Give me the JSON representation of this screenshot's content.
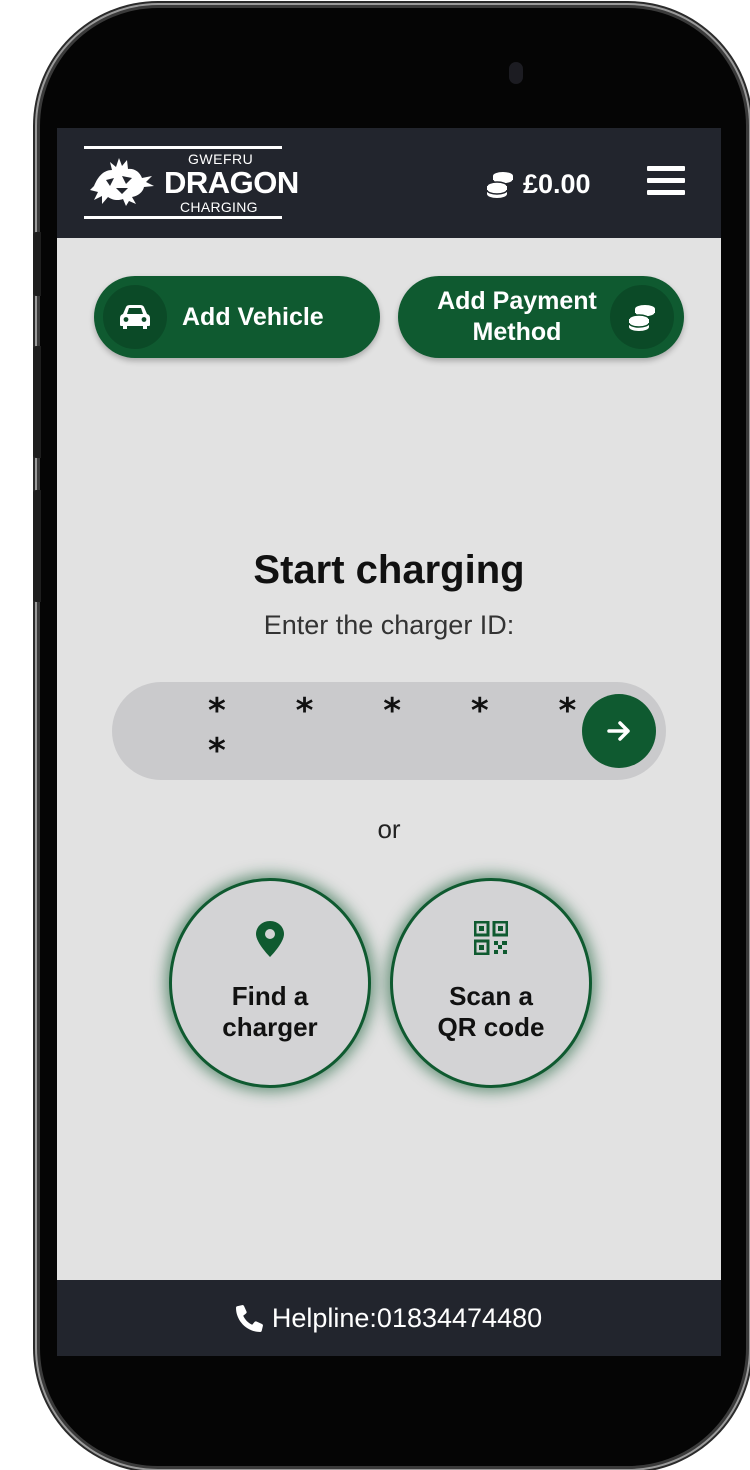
{
  "header": {
    "logo": {
      "line1": "GWEFRU",
      "line2": "DRAGON",
      "line3": "CHARGING"
    },
    "balance": "£0.00",
    "balance_icon": "coins-icon",
    "menu_icon": "hamburger-menu-icon"
  },
  "actions": {
    "add_vehicle": {
      "label": "Add Vehicle",
      "icon": "car-icon"
    },
    "add_payment": {
      "label_line1": "Add Payment",
      "label_line2": "Method",
      "icon": "coins-icon"
    }
  },
  "start": {
    "title": "Start charging",
    "subtitle": "Enter the charger ID:",
    "charger_id_placeholder": "* * * * * *",
    "submit_icon": "arrow-right-icon"
  },
  "divider": "or",
  "options": {
    "find": {
      "line1": "Find a",
      "line2": "charger",
      "icon": "map-pin-icon"
    },
    "scan": {
      "line1": "Scan a",
      "line2": "QR code",
      "icon": "qr-code-icon"
    }
  },
  "footer": {
    "helpline": "Helpline:01834474480",
    "icon": "phone-icon"
  },
  "colors": {
    "header_bg": "#22252d",
    "screen_bg": "#e2e2e2",
    "brand_green": "#0f5a30",
    "field_bg": "#cacacc"
  }
}
